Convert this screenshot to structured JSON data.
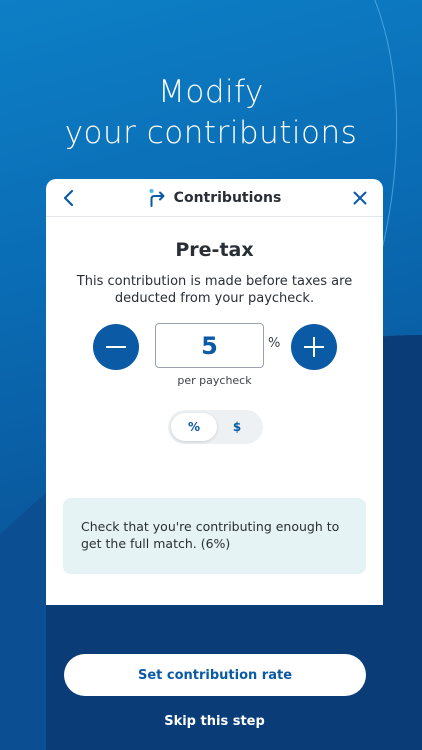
{
  "headline": {
    "line1": "Modify",
    "line2": "your contributions"
  },
  "header": {
    "title": "Contributions",
    "back_icon": "chevron-left-icon",
    "close_icon": "close-icon",
    "title_icon": "redirect-arrow-icon"
  },
  "contribution": {
    "title": "Pre-tax",
    "description": "This contribution is made before taxes are deducted from your paycheck.",
    "value": "5",
    "unit": "%",
    "per_label": "per paycheck"
  },
  "toggle": {
    "options": [
      "%",
      "$"
    ],
    "selected": "%"
  },
  "info": {
    "text": "Check that you're contributing enough to get the full match. (6%)"
  },
  "footer": {
    "primary_label": "Set contribution rate",
    "skip_label": "Skip this step"
  },
  "colors": {
    "accent": "#0a5aa5",
    "footer": "#0a3d78",
    "info_bg": "#e5f3f5"
  }
}
